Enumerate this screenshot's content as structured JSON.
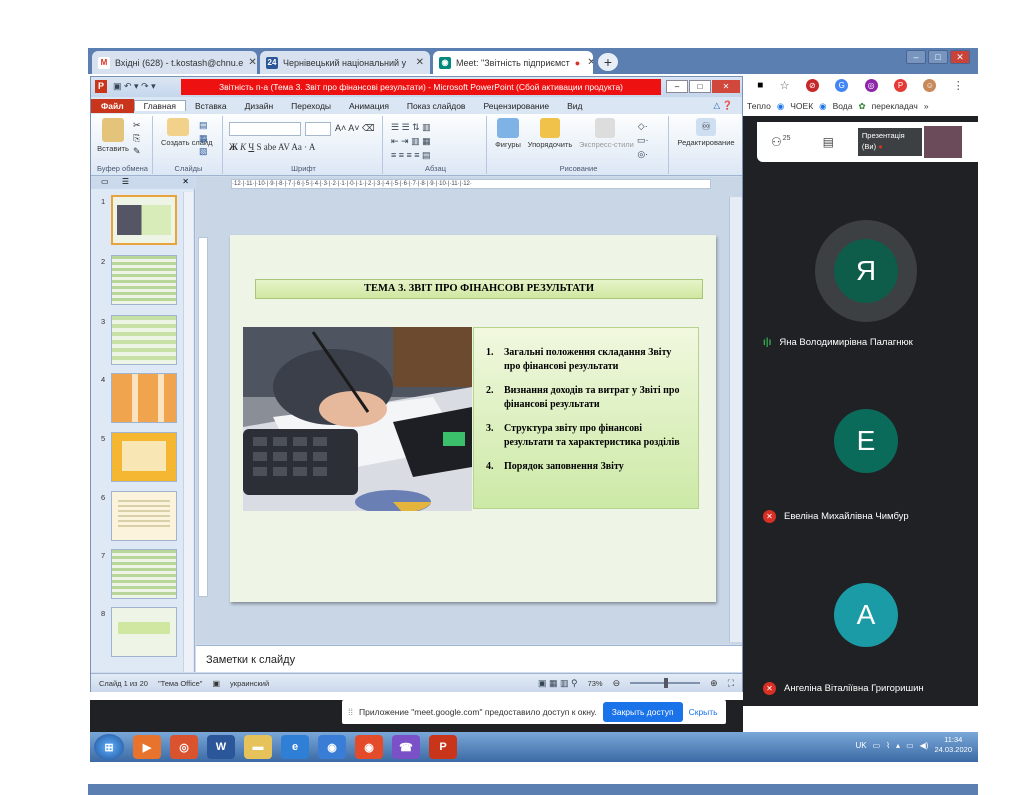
{
  "browser": {
    "tabs": [
      {
        "label": "Вхідні (628) - t.kostash@chnu.e",
        "icon": "gmail-icon",
        "color": "#d93025"
      },
      {
        "label": "Чернівецький національний у",
        "icon": "university-icon",
        "color": "#2b5797"
      },
      {
        "label": "Meet: \"Звітність підприємст",
        "icon": "meet-icon",
        "color": "#00897b"
      }
    ],
    "new_tab": "+",
    "bookmarks": [
      "Тепло",
      "ЧОЕК",
      "Вода",
      "перекладач",
      "»"
    ]
  },
  "meet": {
    "people_count": "25",
    "presentation_label": "Презентація",
    "presentation_sub": "(Ви)",
    "participants": [
      {
        "initial": "Я",
        "name": "Яна Володимирівна Палагнюк",
        "color": "#0e5c4a",
        "mic": "speaking"
      },
      {
        "initial": "Е",
        "name": "Евеліна Михайлівна Чимбур",
        "color": "#0b6b5b",
        "mic": "muted"
      },
      {
        "initial": "А",
        "name": "Ангеліна Віталіївна Григоришин",
        "color": "#1a9ba5",
        "mic": "muted"
      }
    ],
    "share_notice": "Приложение \"meet.google.com\" предоставило доступ к окну.",
    "share_button": "Закрыть доступ",
    "hide_button": "Скрыть"
  },
  "ppt": {
    "title": "Звітність п-а (Тема 3. Звіт про фінансові результати) - Microsoft PowerPoint (Сбой активации продукта)",
    "ribbon_tabs": [
      "Файл",
      "Главная",
      "Вставка",
      "Дизайн",
      "Переходы",
      "Анимация",
      "Показ слайдов",
      "Рецензирование",
      "Вид"
    ],
    "groups": {
      "clipboard": "Буфер обмена",
      "slides": "Слайды",
      "font": "Шрифт",
      "paragraph": "Абзац",
      "drawing": "Рисование"
    },
    "buttons": {
      "paste": "Вставить",
      "new_slide": "Создать слайд",
      "shapes": "Фигуры",
      "arrange": "Упорядочить",
      "quick_styles": "Экспресс-стили",
      "editing": "Редактирование"
    },
    "ruler": "·12·|·11·|·10·|·9·|·8·|·7·|·6·|·5·|·4·|·3·|·2·|·1·|·0·|·1·|·2·|·3·|·4·|·5·|·6·|·7·|·8·|·9·|·10·|·11·|·12·",
    "thumbnails": [
      "1",
      "2",
      "3",
      "4",
      "5",
      "6",
      "7",
      "8"
    ],
    "slide": {
      "title": "ТЕМА 3. ЗВІТ ПРО ФІНАНСОВІ РЕЗУЛЬТАТИ",
      "items": [
        {
          "n": "1.",
          "text": "Загальні положення складання Звіту про фінансові результати"
        },
        {
          "n": "2.",
          "text": "Визнання доходів та витрат у Звіті про фінансові результати"
        },
        {
          "n": "3.",
          "text": "Структура звіту про фінансові результати та характеристика розділів"
        },
        {
          "n": "4.",
          "text": "Порядок заповнення Звіту"
        }
      ]
    },
    "notes_placeholder": "Заметки к слайду",
    "status": {
      "slide_of": "Слайд 1 из 20",
      "theme": "\"Тема Office\"",
      "language": "украинский",
      "zoom": "73%"
    }
  },
  "taskbar": {
    "lang": "UK",
    "time": "11:34",
    "date": "24.03.2020"
  }
}
